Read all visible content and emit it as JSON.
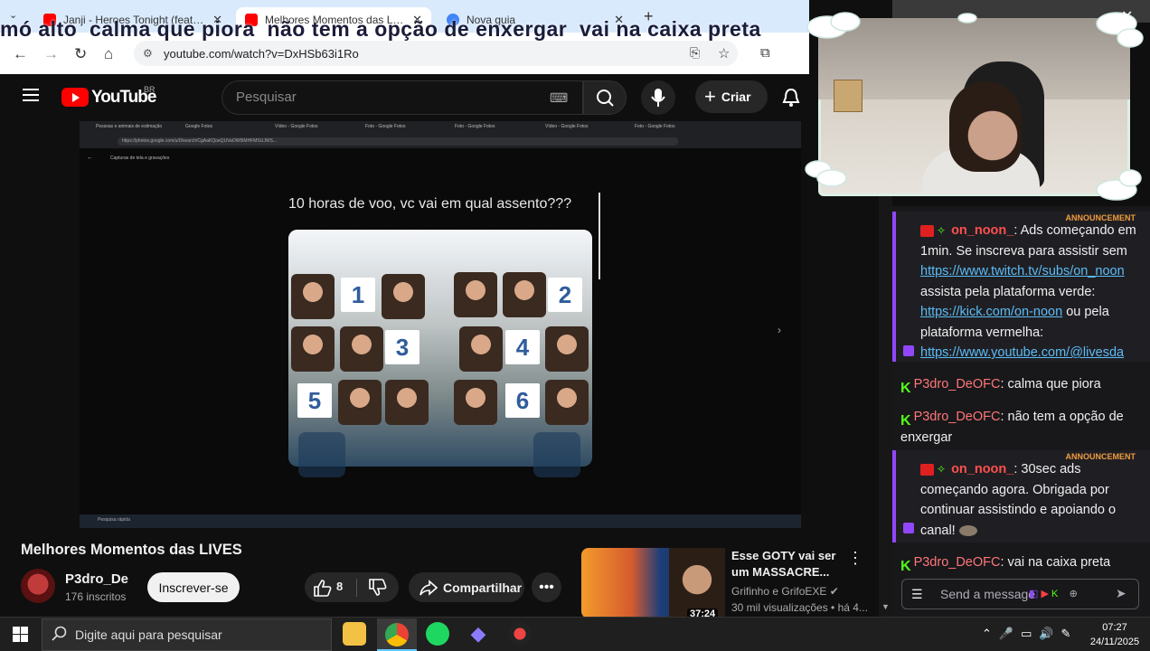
{
  "browser": {
    "tabs": [
      {
        "label": "Janji - Heroes Tonight (feat. Joh",
        "active": false
      },
      {
        "label": "Melhores Momentos das LIVES",
        "active": true
      },
      {
        "label": "Nova guia",
        "active": false
      }
    ],
    "url": "youtube.com/watch?v=DxHSb63i1Ro"
  },
  "chat_ticker": "mó alto  calma que piora  não tem a opção de enxergar  vai na caixa preta",
  "youtube": {
    "logo_text": "YouTube",
    "country": "BR",
    "search_placeholder": "Pesquisar",
    "create_label": "Criar"
  },
  "video": {
    "inner_tabs": [
      "Pessoas e animais de estimação",
      "Google Fotos",
      "Vídeo - Google Fotos",
      "Foto - Google Fotos",
      "Foto - Google Fotos",
      "Vídeo - Google Fotos",
      "Foto - Google Fotos"
    ],
    "inner_url": "https://photos.google.com/u/0/search/CgAaKQoeQUVaOW5lMHFMSUJWS...",
    "inner_breadcrumb": "Capturas de tela e gravações",
    "tweet_title": "10 horas de voo, vc vai em qual assento???",
    "seats": [
      "1",
      "2",
      "3",
      "4",
      "5",
      "6"
    ],
    "inner_search": "Pesquisa rápida",
    "title": "Melhores Momentos das LIVES",
    "channel": "P3dro_De",
    "subscribers": "176 inscritos",
    "subscribe_label": "Inscrever-se",
    "likes": "8",
    "share_label": "Compartilhar"
  },
  "recommendation": {
    "title": "Esse GOTY vai ser um MASSACRE...",
    "channel": "Grifinho e GrifoEXE",
    "meta": "30 mil visualizações • há 4...",
    "duration": "37:24"
  },
  "chat": {
    "announcement_tag": "ANNOUNCEMENT",
    "messages": [
      {
        "user": "on_noon_",
        "text": ": Ads começando em 1min. Se inscreva para assistir sem",
        "link1": "https://www.twitch.tv/subs/on_noon",
        "text2": "assista pela plataforma verde:",
        "link2": "https://kick.com/on-noon",
        "text3": " ou pela plataforma vermelha:",
        "link3": "https://www.youtube.com/@livesda"
      },
      {
        "user": "P3dro_DeOFC",
        "text": ": calma que piora"
      },
      {
        "user": "P3dro_DeOFC",
        "text": ": não tem a opção de enxergar"
      },
      {
        "user": "on_noon_",
        "text": ": 30sec ads começando agora. Obrigada por continuar assistindo e apoiando o canal!"
      },
      {
        "user": "P3dro_DeOFC",
        "text": ": vai na caixa preta"
      }
    ],
    "input_placeholder": "Send a message"
  },
  "taskbar": {
    "search_text": "Digite aqui para pesquisar",
    "time": "07:27",
    "date": "24/11/2025"
  },
  "colors": {
    "yt_red": "#ff0000",
    "twitch_purple": "#9147ff",
    "kick_green": "#53fc18",
    "link_blue": "#5cbcf6"
  }
}
